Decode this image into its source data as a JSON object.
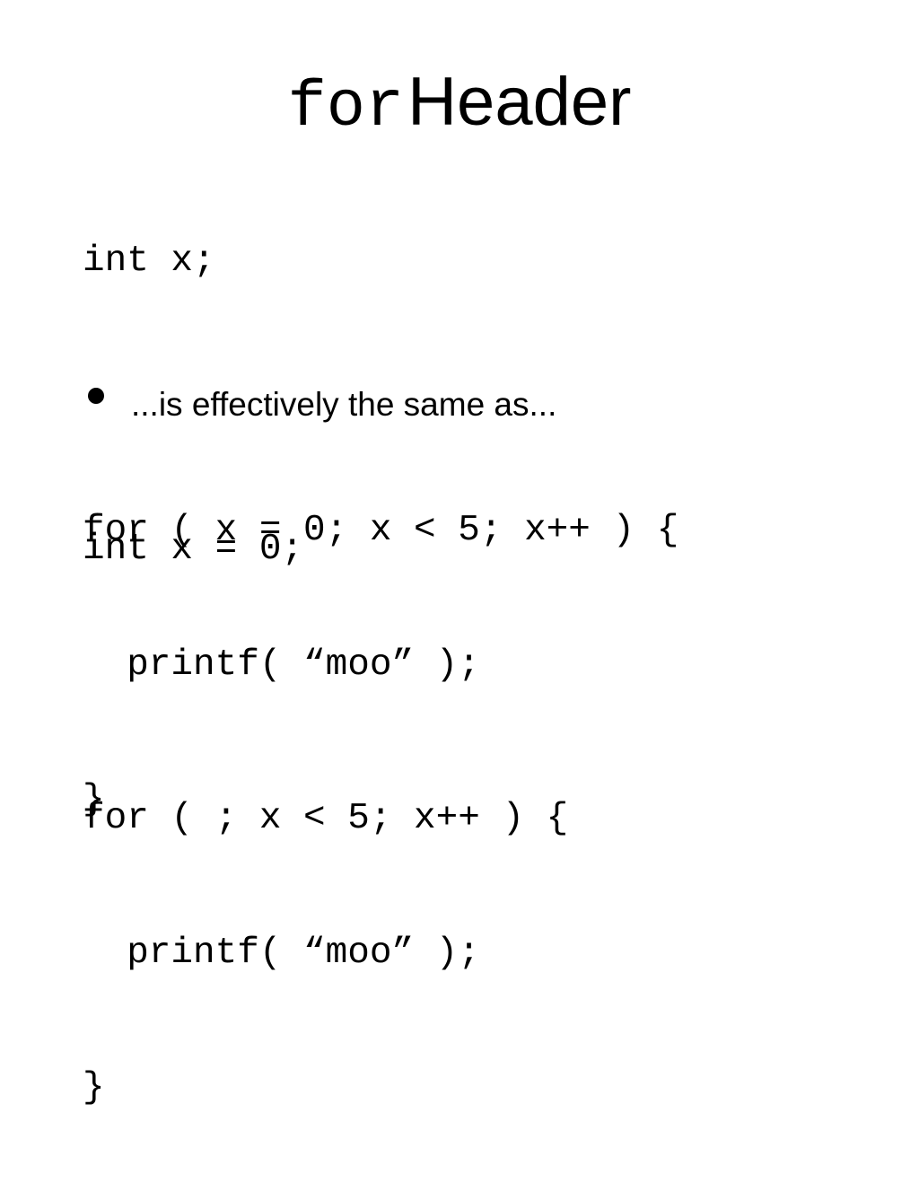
{
  "slide": {
    "title": {
      "code_part": "for",
      "text_part": "Header"
    },
    "code_block_1": [
      "int x;",
      "",
      "for ( x = 0; x < 5; x++ ) {",
      "  printf( “moo” );",
      "}"
    ],
    "bullet": {
      "text": "...is effectively the same as..."
    },
    "code_block_2": [
      "int x = 0;",
      "",
      "for ( ; x < 5; x++ ) {",
      "  printf( “moo” );",
      "}"
    ]
  }
}
